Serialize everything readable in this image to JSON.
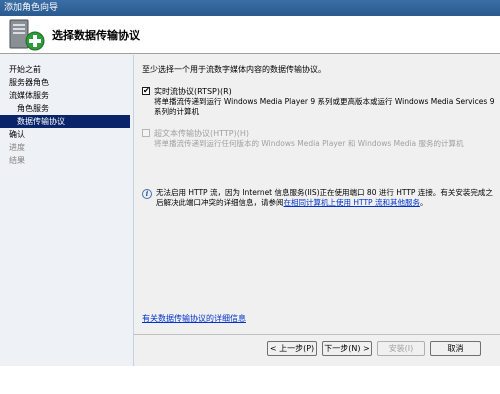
{
  "window": {
    "title": "添加角色向导"
  },
  "header": {
    "title": "选择数据传输协议"
  },
  "sidebar": {
    "items": [
      {
        "label": "开始之前"
      },
      {
        "label": "服务器角色"
      },
      {
        "label": "流媒体服务"
      },
      {
        "label": "角色服务"
      },
      {
        "label": "数据传输协议"
      },
      {
        "label": "确认"
      },
      {
        "label": "进度"
      },
      {
        "label": "结果"
      }
    ]
  },
  "main": {
    "intro": "至少选择一个用于流数字媒体内容的数据传输协议。",
    "options": [
      {
        "label": "实时流协议(RTSP)(R)",
        "description": "将单播流传递到运行 Windows Media Player 9 系列或更高版本或运行 Windows Media Services 9 系列的计算机",
        "checked": true,
        "check_mark": "✔"
      },
      {
        "label": "超文本传输协议(HTTP)(H)",
        "description": "将单播流传递到运行任何版本的 Windows Media Player 和 Windows Media 服务的计算机",
        "checked": false
      }
    ],
    "info": {
      "icon": "info-icon",
      "text": "无法启用 HTTP 流，因为 Internet 信息服务(IIS)正在使用端口 80 进行 HTTP 连接。有关安装完成之后解决此端口冲突的详细信息，请参阅",
      "link": "在相同计算机上使用 HTTP 流和其他服务",
      "tail": "。"
    },
    "more_info_link": "有关数据传输协议的详细信息"
  },
  "buttons": {
    "prev": "< 上一步(P)",
    "next": "下一步(N) >",
    "install": "安装(I)",
    "cancel": "取消"
  },
  "colors": {
    "title_bar": "#3a6ea5",
    "selected_nav": "#0a246a",
    "link": "#0033cc"
  }
}
